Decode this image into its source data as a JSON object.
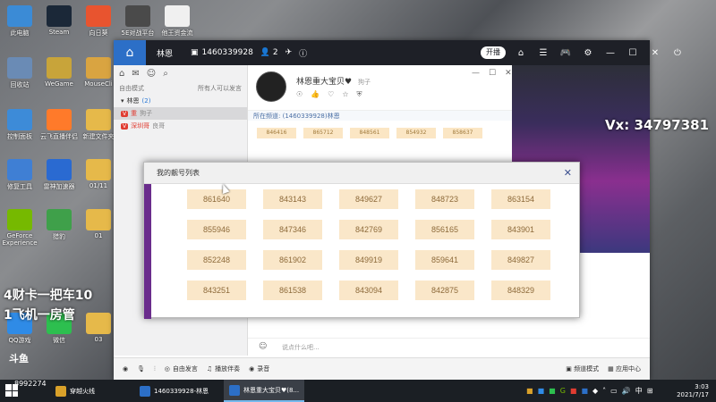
{
  "desktop": {
    "icons": [
      {
        "label": "此电脑",
        "color": "#3b8bd6"
      },
      {
        "label": "Steam",
        "color": "#1b2838"
      },
      {
        "label": "向日葵",
        "color": "#e8542f"
      },
      {
        "label": "5E对战平台",
        "color": "#4a4a4a"
      },
      {
        "label": "他王资金流",
        "color": "#f0f0f0"
      },
      {
        "label": "回收站",
        "color": "#6a8bb5"
      },
      {
        "label": "WeGame",
        "color": "#c8a43a"
      },
      {
        "label": "MouseCli",
        "color": "#d9a441"
      },
      {
        "label": "控制面板",
        "color": "#3d8bd8"
      },
      {
        "label": "云飞直播伴侣",
        "color": "#ff7a2a"
      },
      {
        "label": "新建文件夹",
        "color": "#e6b94a"
      },
      {
        "label": "修复工具",
        "color": "#3f7fd4"
      },
      {
        "label": "雷神加速器",
        "color": "#2a6ad1"
      },
      {
        "label": "01/11",
        "color": "#e6b94a"
      },
      {
        "label": "GeForce Experience",
        "color": "#76b900"
      },
      {
        "label": "猎豹",
        "color": "#3fa04a"
      },
      {
        "label": "01",
        "color": "#e6b94a"
      },
      {
        "label": "QQ游戏",
        "color": "#2f8be6"
      },
      {
        "label": "微信",
        "color": "#2dbf4f"
      },
      {
        "label": "03",
        "color": "#e6b94a"
      }
    ],
    "overlay_line1": "4财卡一把车10",
    "overlay_line2": "1飞机一房管",
    "vx": "Vx: 34797381",
    "douyu_logo": "斗鱼",
    "douyu_room": "8992274"
  },
  "app": {
    "top": {
      "name": "林恩",
      "id": "1460339928",
      "count": "2",
      "open_label": "开播"
    },
    "left": {
      "mode": "自由模式",
      "mode_hint": "所有人可以发言",
      "rows": [
        {
          "text": "林恩",
          "extra": "(2)"
        },
        {
          "text": "重",
          "extra": "狗子"
        },
        {
          "text": "深圳哥",
          "extra": "良哥"
        }
      ]
    },
    "chat": {
      "title": "林恩重大宝贝♥",
      "title_sub": "狗子",
      "channel": "所在频道: (1460339928)林恩",
      "mini_numbers": [
        "846416",
        "865712",
        "848561",
        "854932",
        "858637"
      ]
    },
    "input_placeholder": "说点什么吧...",
    "bottom": {
      "free_speak": "自由发言",
      "music": "播放伴奏",
      "record": "录音",
      "channel_mode": "频道模式",
      "app_center": "应用中心"
    }
  },
  "popup": {
    "title": "我的靓号列表",
    "numbers": [
      "861640",
      "843143",
      "849627",
      "848723",
      "863154",
      "855946",
      "847346",
      "842769",
      "856165",
      "843901",
      "852248",
      "861902",
      "849919",
      "859641",
      "849827",
      "843251",
      "861538",
      "843094",
      "842875",
      "848329"
    ]
  },
  "taskbar": {
    "tasks": [
      {
        "label": "穿越火线",
        "active": false
      },
      {
        "label": "1460339928-林恩",
        "active": false
      },
      {
        "label": "林恩重大宝贝♥(8...",
        "active": true
      }
    ],
    "ime": "中",
    "time": "3:03",
    "date": "2021/7/17"
  }
}
